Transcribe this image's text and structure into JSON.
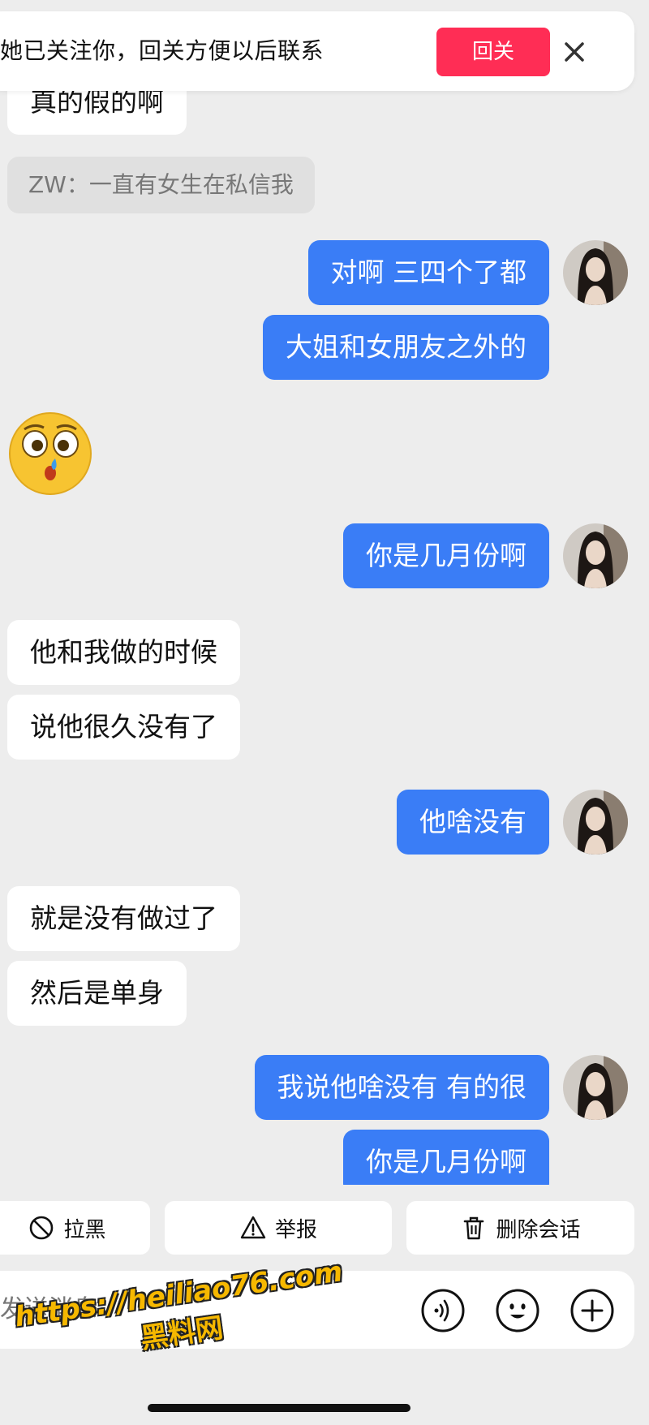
{
  "banner": {
    "text": "她已关注你，回关方便以后联系",
    "follow_label": "回关",
    "close_icon": "close-icon"
  },
  "messages": [
    {
      "side": "in",
      "text": "真的假的啊"
    },
    {
      "side": "quote",
      "text": "ZW：一直有女生在私信我"
    },
    {
      "side": "out",
      "text": "对啊 三四个了都"
    },
    {
      "side": "out",
      "text": "大姐和女朋友之外的"
    },
    {
      "side": "in",
      "type": "emoji",
      "icon": "worried-face-emoji"
    },
    {
      "side": "out",
      "text": "你是几月份啊"
    },
    {
      "side": "in",
      "text": "他和我做的时候"
    },
    {
      "side": "in",
      "text": "说他很久没有了"
    },
    {
      "side": "out",
      "text": "他啥没有"
    },
    {
      "side": "in",
      "text": "就是没有做过了"
    },
    {
      "side": "in",
      "text": "然后是单身"
    },
    {
      "side": "out",
      "text": "我说他啥没有 有的很"
    },
    {
      "side": "out",
      "text": "你是几月份啊"
    }
  ],
  "actions": {
    "block_label": "拉黑",
    "report_label": "举报",
    "delete_label": "删除会话"
  },
  "input": {
    "placeholder": "发送消息",
    "voice_icon": "voice-icon",
    "emoji_icon": "emoji-icon",
    "plus_icon": "plus-icon"
  },
  "watermark": {
    "line1": "https://heiliao76.com",
    "line2": "黑料网"
  },
  "colors": {
    "accent_out": "#3a7df6",
    "follow_button": "#ff2d55",
    "background": "#ededed"
  }
}
